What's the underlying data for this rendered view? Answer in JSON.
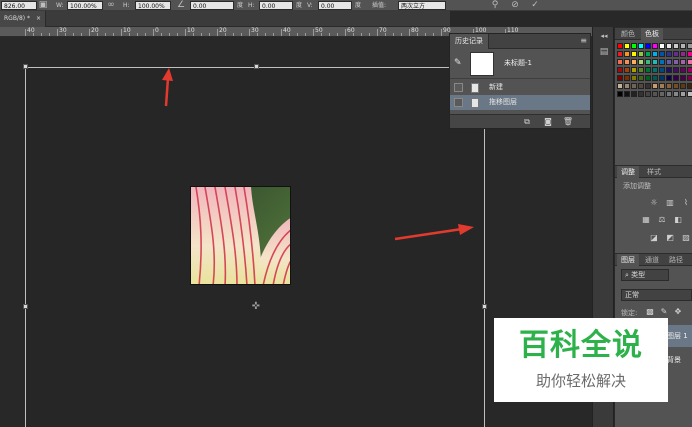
{
  "options_bar": {
    "x_value": "826.00",
    "w_label": "W:",
    "w_value": "100.00%",
    "link_icon": "link-icon",
    "h_label": "H:",
    "h_value": "100.00%",
    "angle_value": "0.00",
    "angle_unit": "度",
    "hskew_label": "H:",
    "hskew_value": "0.00",
    "hskew_unit": "度",
    "vskew_label": "V:",
    "vskew_value": "0.00",
    "vskew_unit": "度",
    "interp_label": "插值:",
    "interp_value": "两次立方",
    "warp_icon": "warp-mode-icon",
    "cancel_icon": "cancel-transform-icon",
    "commit_icon": "commit-transform-icon"
  },
  "doc_tab": {
    "label": "RGB/8) *",
    "close_glyph": "×"
  },
  "ruler": {
    "labels": [
      "40",
      "30",
      "20",
      "10",
      "0",
      "10",
      "20",
      "30",
      "40",
      "50",
      "60",
      "70",
      "80",
      "90",
      "100",
      "110"
    ]
  },
  "history_panel": {
    "tab_label": "历史记录",
    "snapshot_label": "未标题-1",
    "items": [
      {
        "label": "新建",
        "selected": false
      },
      {
        "label": "拖移图层",
        "selected": true
      }
    ],
    "footer_icons": [
      "new-document-from-state-icon",
      "new-snapshot-icon",
      "delete-state-icon"
    ]
  },
  "right_panels": {
    "color_tabs": [
      "颜色",
      "色板"
    ],
    "adjust_tabs": [
      "调整",
      "样式"
    ],
    "adjust_title": "添加调整",
    "layers_tabs": [
      "图层",
      "通道",
      "路径"
    ],
    "filter_kind": "类型",
    "blend_mode": "正常",
    "lock_label": "锁定:",
    "layer_name": "图层 1",
    "bg_layer_name": "背景"
  },
  "colors": {
    "arrow_red": "#e23b2e",
    "selected_row": "#6a7786",
    "panel_bg": "#535353",
    "watermark_green": "#2db14a"
  },
  "watermark": {
    "title": "百科全说",
    "subtitle": "助你轻松解决"
  }
}
